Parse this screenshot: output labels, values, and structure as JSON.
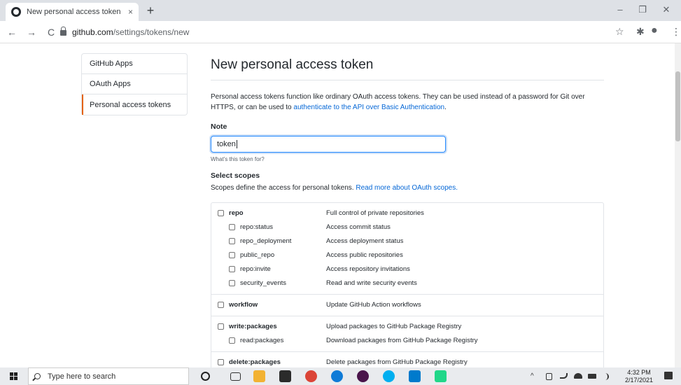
{
  "browser": {
    "tab_title": "New personal access token",
    "tab_close": "×",
    "new_tab": "+",
    "url_host": "github.com",
    "url_path": "/settings/tokens/new",
    "nav_back": "←",
    "nav_forward": "→",
    "nav_reload": "C",
    "window_min": "–",
    "window_restore": "❐",
    "window_close": "✕",
    "star": "☆",
    "extensions": "✱",
    "profile": "●",
    "menu": "⋮"
  },
  "sidebar": {
    "items": [
      {
        "label": "GitHub Apps"
      },
      {
        "label": "OAuth Apps"
      },
      {
        "label": "Personal access tokens"
      }
    ]
  },
  "main": {
    "title": "New personal access token",
    "intro_text": "Personal access tokens function like ordinary OAuth access tokens. They can be used instead of a password for Git over HTTPS, or can be used to ",
    "intro_link": "authenticate to the API over Basic Authentication",
    "intro_end": ".",
    "note_label": "Note",
    "note_value": "token",
    "note_help": "What's this token for?",
    "scopes_label": "Select scopes",
    "scopes_desc": "Scopes define the access for personal tokens. ",
    "scopes_link": "Read more about OAuth scopes.",
    "scopes": {
      "repo": {
        "name": "repo",
        "desc": "Full control of private repositories"
      },
      "repo_status": {
        "name": "repo:status",
        "desc": "Access commit status"
      },
      "repo_deployment": {
        "name": "repo_deployment",
        "desc": "Access deployment status"
      },
      "public_repo": {
        "name": "public_repo",
        "desc": "Access public repositories"
      },
      "repo_invite": {
        "name": "repo:invite",
        "desc": "Access repository invitations"
      },
      "security_events": {
        "name": "security_events",
        "desc": "Read and write security events"
      },
      "workflow": {
        "name": "workflow",
        "desc": "Update GitHub Action workflows"
      },
      "write_packages": {
        "name": "write:packages",
        "desc": "Upload packages to GitHub Package Registry"
      },
      "read_packages": {
        "name": "read:packages",
        "desc": "Download packages from GitHub Package Registry"
      },
      "delete_packages": {
        "name": "delete:packages",
        "desc": "Delete packages from GitHub Package Registry"
      }
    }
  },
  "taskbar": {
    "search_placeholder": "Type here to search",
    "time": "4:32 PM",
    "date": "2/17/2021"
  }
}
